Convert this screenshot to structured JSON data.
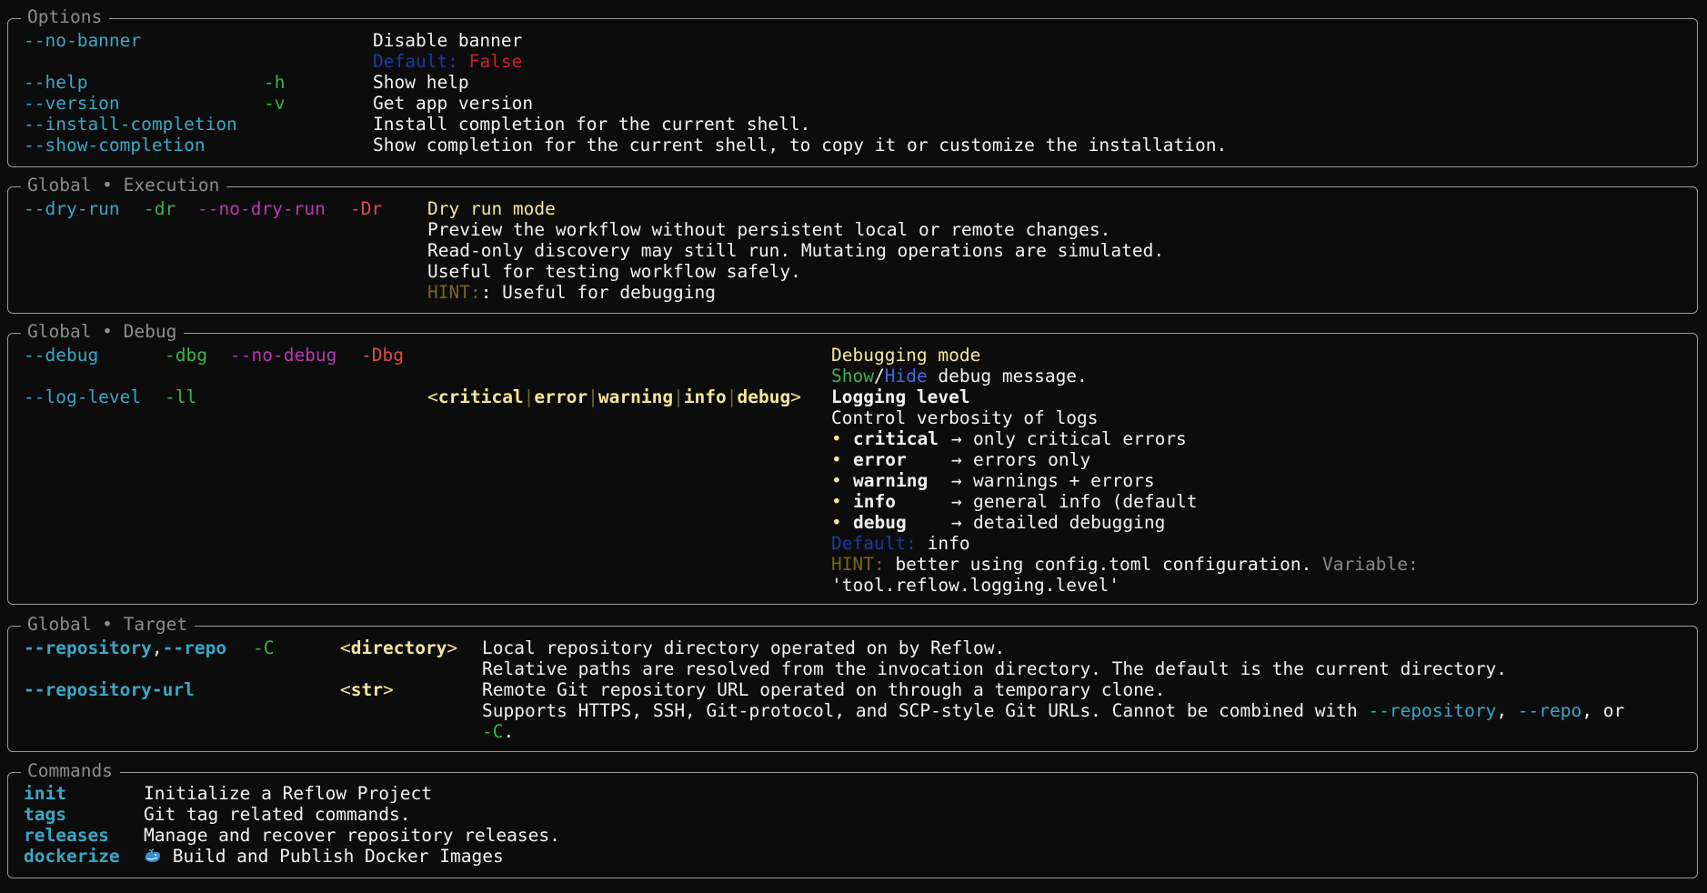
{
  "options": {
    "title": "Options",
    "rows": [
      {
        "flag": "--no-banner",
        "short": "",
        "desc": "Disable banner"
      },
      {
        "flag": "--help",
        "short": "-h",
        "desc": "Show help"
      },
      {
        "flag": "--version",
        "short": "-v",
        "desc": "Get app version"
      },
      {
        "flag": "--install-completion",
        "short": "",
        "desc": "Install completion for the current shell."
      },
      {
        "flag": "--show-completion",
        "short": "",
        "desc": "Show completion for the current shell, to copy it or customize the installation."
      }
    ],
    "default_label": "Default:",
    "default_value": "False"
  },
  "execution": {
    "title": "Global • Execution",
    "flag": "--dry-run",
    "short": "-dr",
    "neg_flag": "--no-dry-run",
    "neg_short": "-Dr",
    "heading": "Dry run mode",
    "lines": [
      "Preview the workflow without persistent local or remote changes.",
      "Read-only discovery may still run. Mutating operations are simulated.",
      "Useful for testing workflow safely."
    ],
    "hint_label": "HINT:",
    "hint_text": ": Useful for debugging"
  },
  "debug": {
    "title": "Global • Debug",
    "flag": "--debug",
    "short": "-dbg",
    "neg_flag": "--no-debug",
    "neg_short": "-Dbg",
    "heading": "Debugging mode",
    "show": "Show",
    "slash": "/",
    "hide": "Hide",
    "show_hide_rest": " debug message.",
    "log_flag": "--log-level",
    "log_short": "-ll",
    "choices_open": "<",
    "choices": [
      "critical",
      "error",
      "warning",
      "info",
      "debug"
    ],
    "choices_sep": "|",
    "choices_close": ">",
    "log_heading": "Logging level",
    "log_sub": "Control verbosity of logs",
    "bullet": "•",
    "arrow": "→",
    "levels": [
      {
        "name": "critical",
        "desc": "only critical errors"
      },
      {
        "name": "error",
        "desc": "errors only"
      },
      {
        "name": "warning",
        "desc": "warnings + errors"
      },
      {
        "name": "info",
        "desc": "general info (default"
      },
      {
        "name": "debug",
        "desc": "detailed debugging"
      }
    ],
    "default_label": "Default:",
    "default_value": " info",
    "hint_label": "HINT:",
    "hint_text": " better using config.toml configuration.",
    "variable_label": " Variable:",
    "variable_value": "'tool.reflow.logging.level'"
  },
  "target": {
    "title": "Global • Target",
    "repo_flag": "--repository",
    "repo_comma": ",",
    "repo_alias": "--repo",
    "repo_short": "-C",
    "repo_meta_open": "<",
    "repo_meta": "directory",
    "repo_meta_close": ">",
    "repo_desc_1": "Local repository directory operated on by Reflow.",
    "repo_desc_2": "Relative paths are resolved from the invocation directory. The default is the current directory.",
    "url_flag": "--repository-url",
    "url_meta_open": "<",
    "url_meta": "str",
    "url_meta_close": ">",
    "url_desc_1": "Remote Git repository URL operated on through a temporary clone.",
    "url_desc_2_a": "Supports HTTPS, SSH, Git-protocol, and SCP-style Git URLs. Cannot be combined with ",
    "url_desc_2_b": "--repository",
    "url_desc_2_c": ", ",
    "url_desc_2_d": "--repo",
    "url_desc_2_e": ", or",
    "url_desc_3_a": "-C",
    "url_desc_3_b": "."
  },
  "commands": {
    "title": "Commands",
    "items": [
      {
        "name": "init",
        "desc": "Initialize a Reflow Project"
      },
      {
        "name": "tags",
        "desc": "Git tag related commands."
      },
      {
        "name": "releases",
        "desc": "Manage and recover repository releases."
      },
      {
        "name": "dockerize",
        "desc": " Build and Publish Docker Images"
      }
    ]
  },
  "colors": {
    "background": "#0c0c0c",
    "border": "#9a9a9a",
    "flag": "#3aa7c7",
    "short_flag": "#3bb54a",
    "negative_flag": "#b63ab3",
    "negative_short": "#e04a4a",
    "heading": "#f6e69b",
    "default_label": "#1c3b9c",
    "hint_label": "#7a6418",
    "default_false": "#cc1f2e"
  }
}
